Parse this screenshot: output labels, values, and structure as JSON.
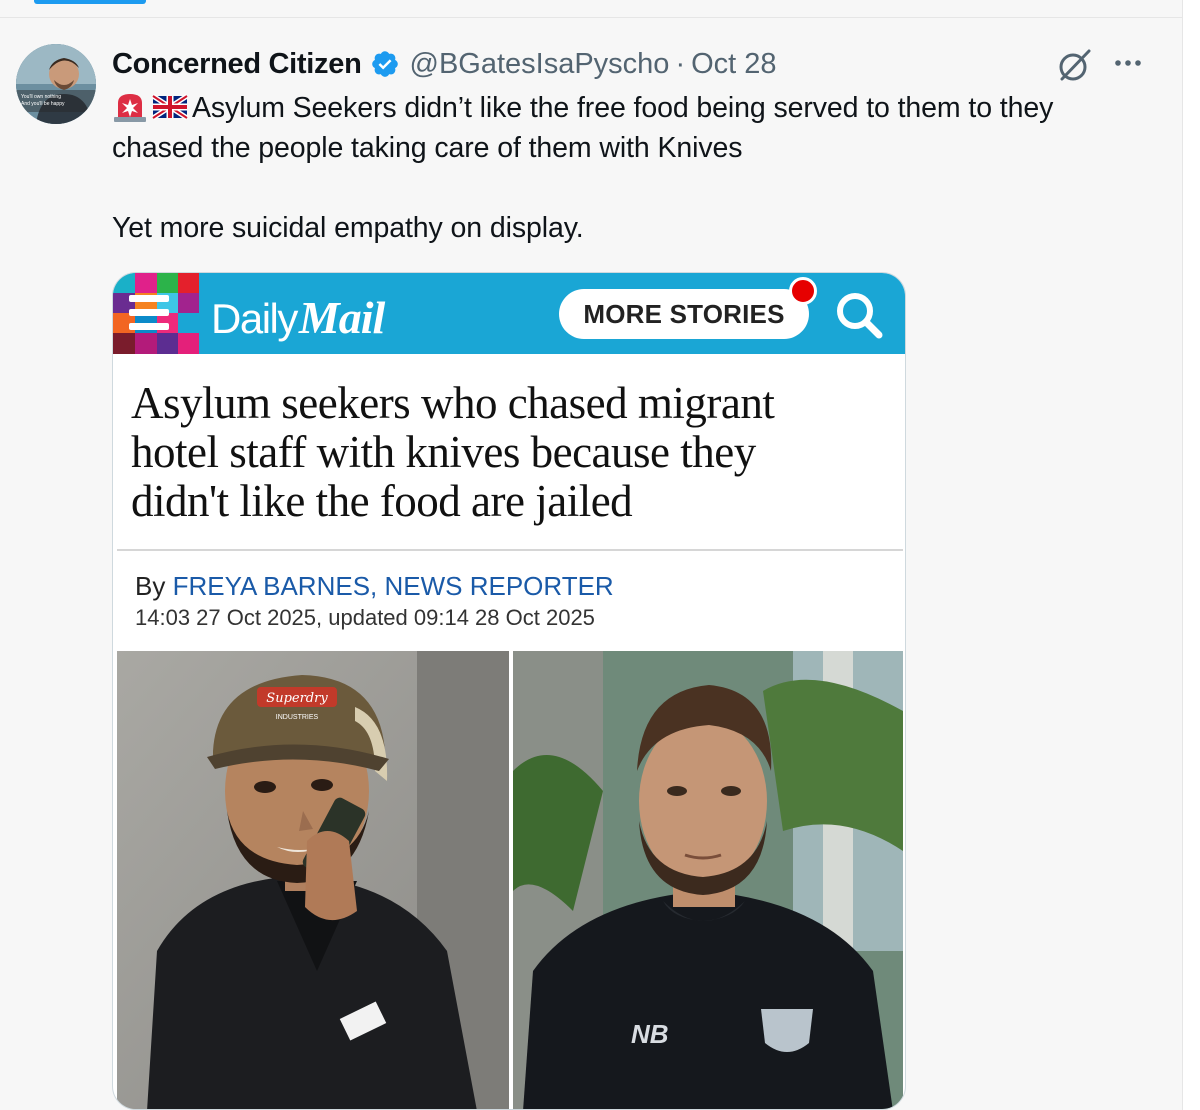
{
  "tweet": {
    "author": {
      "display_name": "Concerned Citizen",
      "handle": "@BGatesIsaPyscho",
      "verified": true,
      "avatar_caption": [
        "You'll own nothing",
        "And you'll be happy"
      ]
    },
    "separator": "·",
    "date": "Oct 28",
    "emojis": [
      "rotating-light-emoji",
      "uk-flag-emoji"
    ],
    "text_lines": [
      "Asylum Seekers didn’t like the free food being served to them to they",
      "chased the people taking care of them with Knives",
      "Yet more suicidal empathy on display."
    ],
    "icons": {
      "grok": "grok-icon",
      "more": "more-icon",
      "verified": "verified-badge-icon"
    },
    "colors": {
      "accent": "#1d9bf0",
      "secondary_text": "#536471"
    }
  },
  "article_card": {
    "publication": {
      "logo_part1": "Daily",
      "logo_part2": "Mail",
      "header_color": "#1aa6d5"
    },
    "more_stories_label": "MORE STORIES",
    "headline_lines": [
      "Asylum seekers who chased migrant",
      "hotel staff with knives because they",
      "didn't like the food are jailed"
    ],
    "byline_prefix": "By",
    "author": "FREYA BARNES, NEWS REPORTER",
    "timestamp": "14:03 27 Oct 2025, updated 09:14 28 Oct 2025",
    "photo_texts": {
      "left_cap_brand": "Superdry",
      "left_cap_sub": "INDUSTRIES",
      "right_shirt_logo": "NB"
    }
  }
}
